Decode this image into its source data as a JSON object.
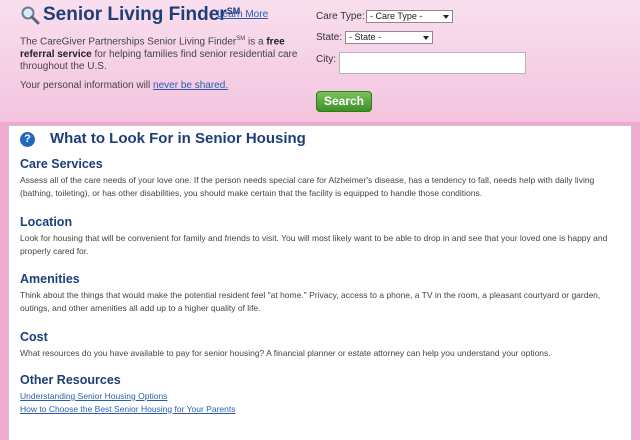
{
  "finder": {
    "title": "Senior Living Finder",
    "title_mark": "SM",
    "learn_more": "Learn More",
    "intro_lead": "The CareGiver Partnerships Senior Living Finder",
    "intro_mark": "SM",
    "intro_mid": " is a ",
    "intro_bold": "free referral service",
    "intro_tail": " for helping families find senior residential care throughout the U.S.",
    "privacy_lead": "Your personal information will ",
    "privacy_link": "never be shared.",
    "care_type_label": "Care Type:",
    "care_type_value": "- Care Type -",
    "state_label": "State:",
    "state_value": "- State -",
    "city_label": "City:",
    "city_value": "",
    "search_label": "Search"
  },
  "main": {
    "title": "What to Look For in Senior Housing",
    "sections": [
      {
        "heading": "Care Services",
        "text": "Assess all of the care needs of your love one. If the person needs special care for Alzheimer's disease, has a tendency to fall, needs help with daily living (bathing, toileting), or has other disabilities, you should make certain that the facility is equipped to handle those conditions."
      },
      {
        "heading": "Location",
        "text": "Look for housing that will be convenient for family and friends to visit. You will most likely want to be able to drop in and see that your loved one is happy and properly cared for."
      },
      {
        "heading": "Amenities",
        "text": "Think about the things that would make the potential resident feel \"at home.\" Privacy, access to a phone, a TV in the room, a pleasant courtyard or garden, outings, and other amenities all add up to a higher quality of life."
      },
      {
        "heading": "Cost",
        "text": "What resources do you have available to pay for senior housing? A financial planner or estate attorney can help you understand your options."
      }
    ],
    "resources_heading": "Other Resources",
    "resources": [
      "Understanding Senior Housing Options",
      "How to Choose the Best Senior Housing for Your Parents"
    ]
  },
  "colors": {
    "background_pink": "#f0a9cf",
    "heading_navy": "#1d3f78",
    "link_blue": "#2a5db0",
    "search_green": "#4ea335"
  },
  "icons": [
    "magnifier-icon",
    "help-icon",
    "chevron-down-icon"
  ]
}
